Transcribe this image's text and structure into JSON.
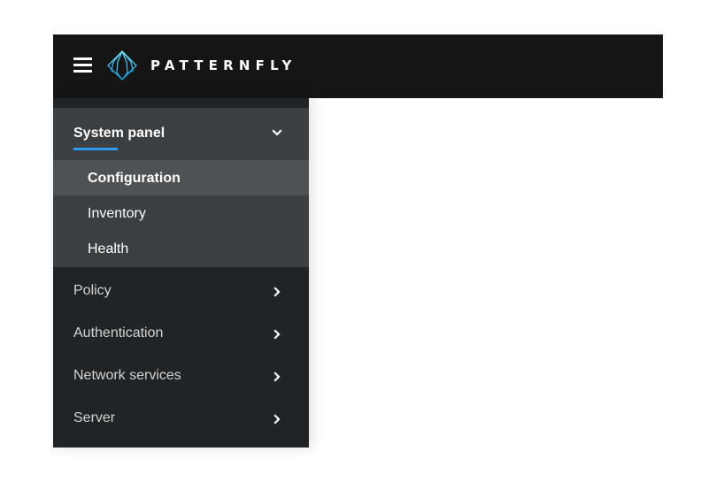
{
  "masthead": {
    "menu_icon": "hamburger-menu-icon",
    "brand_logo": "patternfly-logo-icon",
    "brand_name": "PATTERNFLY"
  },
  "sidebar": {
    "expanded_section": {
      "label": "System panel",
      "icon": "chevron-down-icon",
      "items": [
        {
          "label": "Configuration",
          "current": true
        },
        {
          "label": "Inventory",
          "current": false
        },
        {
          "label": "Health",
          "current": false
        }
      ]
    },
    "items": [
      {
        "label": "Policy",
        "icon": "chevron-right-icon"
      },
      {
        "label": "Authentication",
        "icon": "chevron-right-icon"
      },
      {
        "label": "Network services",
        "icon": "chevron-right-icon"
      },
      {
        "label": "Server",
        "icon": "chevron-right-icon"
      }
    ]
  },
  "colors": {
    "masthead_bg": "#151515",
    "sidebar_bg": "#212427",
    "expanded_section_bg": "#3c3f42",
    "current_item_bg": "#4f5255",
    "accent": "#2b9af3",
    "logo": "#2bc5f3"
  }
}
